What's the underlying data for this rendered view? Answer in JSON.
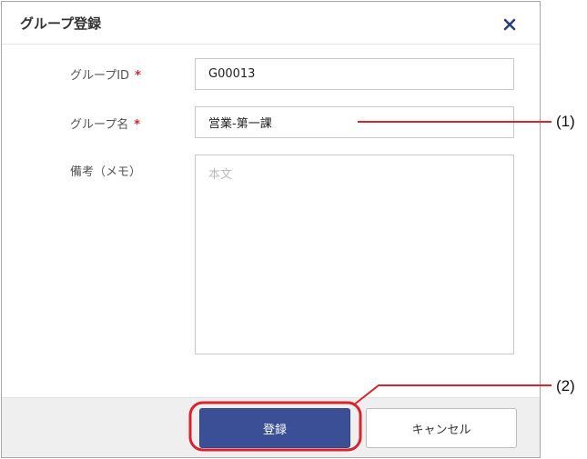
{
  "dialog": {
    "title": "グループ登録",
    "close_icon": "close-icon"
  },
  "form": {
    "group_id": {
      "label": "グループID",
      "required_mark": "*",
      "value": "G00013"
    },
    "group_name": {
      "label": "グループ名",
      "required_mark": "*",
      "value": "営業-第一課"
    },
    "memo": {
      "label": "備考（メモ）",
      "placeholder": "本文",
      "value": ""
    }
  },
  "footer": {
    "register_label": "登録",
    "cancel_label": "キャンセル"
  },
  "annotations": {
    "callout_1": "(1)",
    "callout_2": "(2)",
    "color": "#d9232d"
  },
  "colors": {
    "primary_button": "#3a4f95",
    "required_mark": "#d9232d",
    "close_icon": "#2c3e7a"
  }
}
